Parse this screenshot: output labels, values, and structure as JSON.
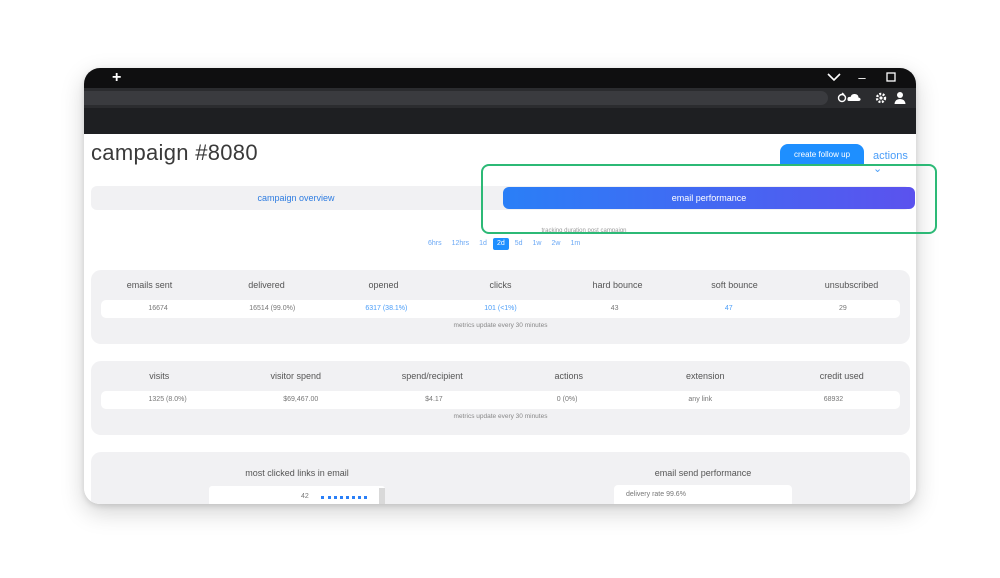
{
  "window": {
    "titlebar": {
      "new_tab": "+",
      "dropdown": "⌵",
      "minimize": "–",
      "maximize": "☐"
    },
    "toolbar_icons": [
      "sync-icon",
      "cloud-icon",
      "gear-icon",
      "user-icon"
    ]
  },
  "header": {
    "title": "campaign #8080",
    "follow_up_button": "create follow up",
    "actions": "actions ⌄"
  },
  "tabs": {
    "overview": "campaign overview",
    "performance": "email performance",
    "active": "email performance"
  },
  "tracking": {
    "label": "tracking duration post campaign",
    "durations": [
      "6hrs",
      "12hrs",
      "1d",
      "2d",
      "5d",
      "1w",
      "2w",
      "1m"
    ],
    "selected": "2d"
  },
  "email_metrics": {
    "headers": [
      "emails sent",
      "delivered",
      "opened",
      "clicks",
      "hard bounce",
      "soft bounce",
      "unsubscribed"
    ],
    "values": [
      "16674",
      "16514 (99.0%)",
      "6317 (38.1%)",
      "101 (<1%)",
      "43",
      "47",
      "29"
    ],
    "note": "metrics update every 30 minutes"
  },
  "visit_metrics": {
    "headers": [
      "visits",
      "visitor spend",
      "spend/recipient",
      "actions",
      "extension",
      "credit used"
    ],
    "values": [
      "1325 (8.0%)",
      "$69,467.00",
      "$4.17",
      "0 (0%)",
      "any link",
      "68932"
    ],
    "note": "metrics update every 30 minutes"
  },
  "bottom": {
    "links_title": "most clicked links in email",
    "links_count": "42",
    "perf_title": "email send performance",
    "delivery_rate": "delivery rate 99.6%"
  },
  "colors": {
    "accent": "#1e8fff",
    "gradient_end": "#5b52ee",
    "highlight": "#2cb976",
    "link": "#4a9df8"
  }
}
